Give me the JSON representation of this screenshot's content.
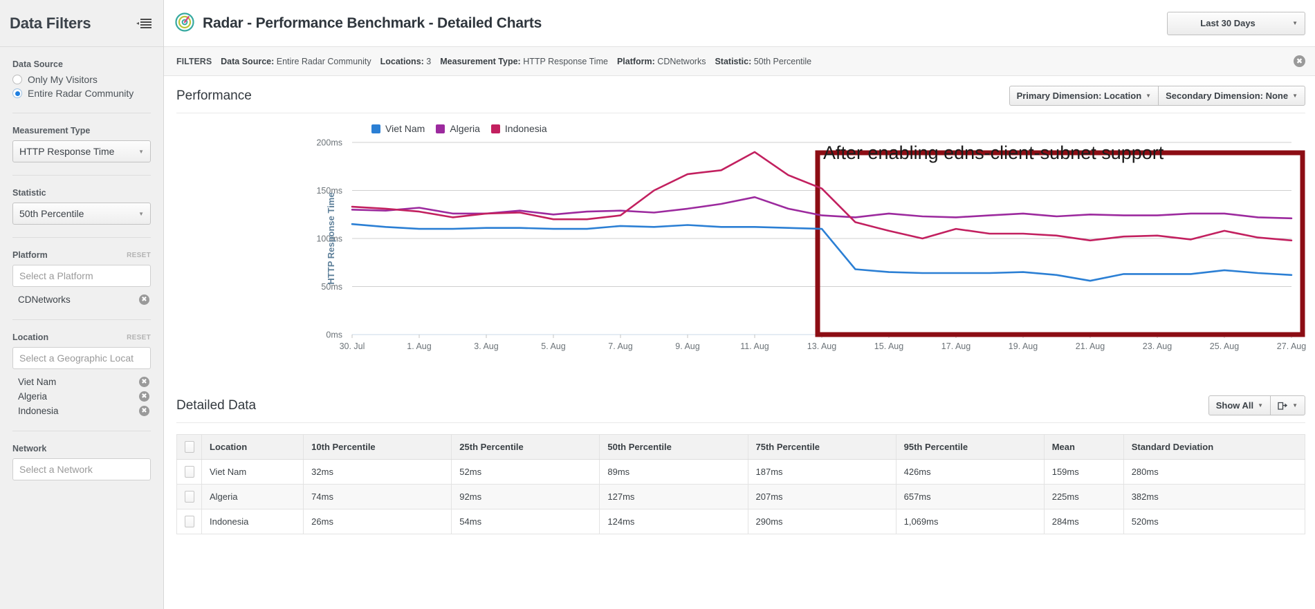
{
  "sidebar": {
    "title": "Data Filters",
    "collapse_icon": "collapse-sidebar-icon",
    "groups": {
      "data_source": {
        "label": "Data Source",
        "options": [
          {
            "label": "Only My Visitors",
            "selected": false
          },
          {
            "label": "Entire Radar Community",
            "selected": true
          }
        ]
      },
      "measurement_type": {
        "label": "Measurement Type",
        "value": "HTTP Response Time"
      },
      "statistic": {
        "label": "Statistic",
        "value": "50th Percentile"
      },
      "platform": {
        "label": "Platform",
        "reset_label": "RESET",
        "placeholder": "Select a Platform",
        "chips": [
          "CDNetworks"
        ]
      },
      "location": {
        "label": "Location",
        "reset_label": "RESET",
        "placeholder": "Select a Geographic Locat",
        "chips": [
          "Viet Nam",
          "Algeria",
          "Indonesia"
        ]
      },
      "network": {
        "label": "Network",
        "placeholder": "Select a Network",
        "chips": []
      }
    }
  },
  "header": {
    "logo_icon": "radar-target-icon",
    "title": "Radar - Performance Benchmark - Detailed Charts",
    "date_range": "Last 30 Days"
  },
  "filterbar": {
    "label": "FILTERS",
    "items": [
      {
        "key": "Data Source:",
        "value": "Entire Radar Community"
      },
      {
        "key": "Locations:",
        "value": "3"
      },
      {
        "key": "Measurement Type:",
        "value": "HTTP Response Time"
      },
      {
        "key": "Platform:",
        "value": "CDNetworks"
      },
      {
        "key": "Statistic:",
        "value": "50th Percentile"
      }
    ],
    "close_icon": "close-icon"
  },
  "performance_section": {
    "title": "Performance",
    "primary_dimension": "Primary Dimension: Location",
    "secondary_dimension": "Secondary Dimension: None"
  },
  "annotation": {
    "text": "After enabling edns-client-subnet support",
    "box_color": "#8c0d14",
    "box_start_date": "13. Aug",
    "box_end_date": "27. Aug"
  },
  "detailed_data_section": {
    "title": "Detailed Data",
    "show_all_label": "Show All",
    "export_icon": "export-icon"
  },
  "table": {
    "columns": [
      "Location",
      "10th Percentile",
      "25th Percentile",
      "50th Percentile",
      "75th Percentile",
      "95th Percentile",
      "Mean",
      "Standard Deviation"
    ],
    "rows": [
      {
        "cells": [
          "Viet Nam",
          "32ms",
          "52ms",
          "89ms",
          "187ms",
          "426ms",
          "159ms",
          "280ms"
        ]
      },
      {
        "cells": [
          "Algeria",
          "74ms",
          "92ms",
          "127ms",
          "207ms",
          "657ms",
          "225ms",
          "382ms"
        ]
      },
      {
        "cells": [
          "Indonesia",
          "26ms",
          "54ms",
          "124ms",
          "290ms",
          "1,069ms",
          "284ms",
          "520ms"
        ]
      }
    ]
  },
  "chart_data": {
    "type": "line",
    "title": "Performance",
    "xlabel": "",
    "ylabel": "HTTP Response Time",
    "ylim": [
      0,
      200
    ],
    "yticks": [
      0,
      50,
      100,
      150,
      200
    ],
    "ytick_labels": [
      "0ms",
      "50ms",
      "100ms",
      "150ms",
      "200ms"
    ],
    "grid": true,
    "legend_position": "top-left",
    "x": [
      "30. Jul",
      "31. Jul",
      "1. Aug",
      "2. Aug",
      "3. Aug",
      "4. Aug",
      "5. Aug",
      "6. Aug",
      "7. Aug",
      "8. Aug",
      "9. Aug",
      "10. Aug",
      "11. Aug",
      "12. Aug",
      "13. Aug",
      "14. Aug",
      "15. Aug",
      "16. Aug",
      "17. Aug",
      "18. Aug",
      "19. Aug",
      "20. Aug",
      "21. Aug",
      "22. Aug",
      "23. Aug",
      "24. Aug",
      "25. Aug",
      "26. Aug",
      "27. Aug"
    ],
    "xtick_labels": [
      "30. Jul",
      "1. Aug",
      "3. Aug",
      "5. Aug",
      "7. Aug",
      "9. Aug",
      "11. Aug",
      "13. Aug",
      "15. Aug",
      "17. Aug",
      "19. Aug",
      "21. Aug",
      "23. Aug",
      "25. Aug",
      "27. Aug"
    ],
    "series": [
      {
        "name": "Viet Nam",
        "color": "#2b7fd4",
        "values": [
          115,
          112,
          110,
          110,
          111,
          111,
          110,
          110,
          113,
          112,
          114,
          112,
          112,
          111,
          110,
          68,
          65,
          64,
          64,
          64,
          65,
          62,
          56,
          63,
          63,
          63,
          67,
          64,
          62
        ]
      },
      {
        "name": "Algeria",
        "color": "#9c2a9e",
        "values": [
          130,
          129,
          132,
          126,
          126,
          129,
          125,
          128,
          129,
          127,
          131,
          136,
          143,
          131,
          124,
          122,
          126,
          123,
          122,
          124,
          126,
          123,
          125,
          124,
          124,
          126,
          126,
          122,
          121
        ]
      },
      {
        "name": "Indonesia",
        "color": "#c2205f",
        "values": [
          133,
          131,
          128,
          122,
          126,
          127,
          120,
          120,
          124,
          150,
          167,
          171,
          190,
          166,
          152,
          117,
          108,
          100,
          110,
          105,
          105,
          103,
          98,
          102,
          103,
          99,
          108,
          101,
          98
        ]
      }
    ]
  }
}
